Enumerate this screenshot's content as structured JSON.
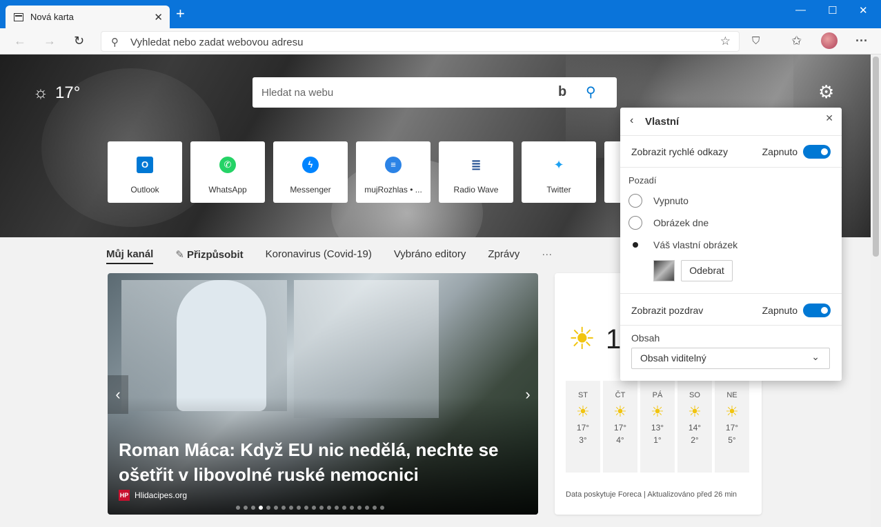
{
  "browser": {
    "tab_title": "Nová karta",
    "tab_close": "✕",
    "new_tab": "+",
    "address_placeholder": "Vyhledat nebo zadat webovou adresu"
  },
  "hero": {
    "temperature": "17°",
    "search_placeholder": "Hledat na webu",
    "bing": "b",
    "tiles": [
      {
        "label": "Outlook",
        "icon": "O",
        "color": "#0078d4"
      },
      {
        "label": "WhatsApp",
        "icon": "✆",
        "color": "#25d366"
      },
      {
        "label": "Messenger",
        "icon": "ϟ",
        "color": "#0084ff"
      },
      {
        "label": "mujRozhlas • ...",
        "icon": "≡",
        "color": "#2b83e6"
      },
      {
        "label": "Radio Wave",
        "icon": "≣",
        "color": "#1d4b8f"
      },
      {
        "label": "Twitter",
        "icon": "🐦",
        "color": "#1da1f2"
      }
    ]
  },
  "feed_nav": {
    "my_feed": "Můj kanál",
    "personalize": "Přizpůsobit",
    "corona": "Koronavirus (Covid-19)",
    "editors": "Vybráno editory",
    "news": "Zprávy",
    "more": "···"
  },
  "article": {
    "headline": "Roman Máca: Když EU nic nedělá, nechte se ošetřit v libovolné ruské nemocnici",
    "source": "Hlidacipes.org",
    "source_logo": "HP",
    "prev": "‹",
    "next": "›"
  },
  "weather_card": {
    "current_temp": "1",
    "days": [
      {
        "name": "ST",
        "high": "17°",
        "low": "3°"
      },
      {
        "name": "ČT",
        "high": "17°",
        "low": "4°"
      },
      {
        "name": "PÁ",
        "high": "13°",
        "low": "1°"
      },
      {
        "name": "SO",
        "high": "14°",
        "low": "2°"
      },
      {
        "name": "NE",
        "high": "17°",
        "low": "5°"
      }
    ],
    "footer": "Data poskytuje Foreca | Aktualizováno před 26 min"
  },
  "settings": {
    "title": "Vlastní",
    "quick_links_label": "Zobrazit rychlé odkazy",
    "quick_links_state": "Zapnuto",
    "background_label": "Pozadí",
    "options": [
      "Vypnuto",
      "Obrázek dne",
      "Váš vlastní obrázek"
    ],
    "selected_option": "Váš vlastní obrázek",
    "remove_button": "Odebrat",
    "greeting_label": "Zobrazit pozdrav",
    "greeting_state": "Zapnuto",
    "content_label": "Obsah",
    "content_value": "Obsah viditelný"
  }
}
